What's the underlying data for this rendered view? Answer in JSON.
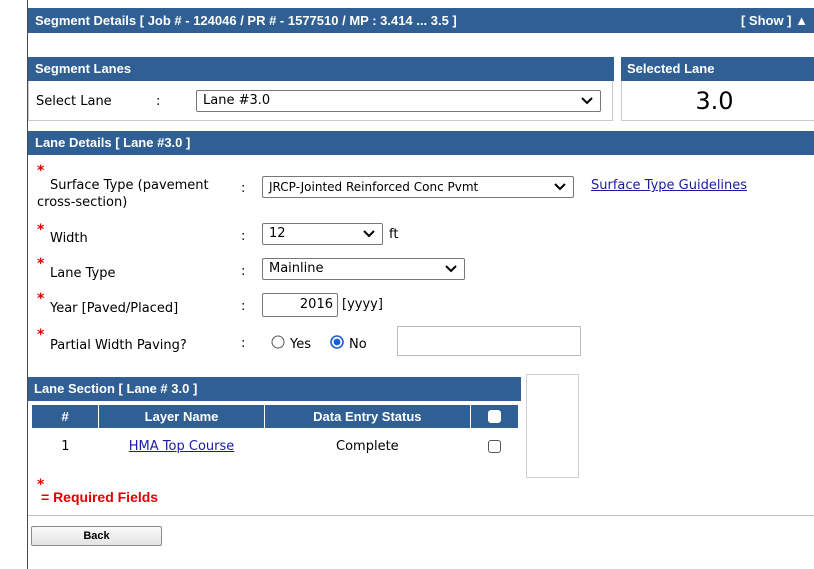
{
  "segment_header": {
    "title": "Segment Details [ Job # - 124046 / PR # - 1577510 / MP : 3.414 ... 3.5 ]",
    "toggle_label": "[ Show ] ▲"
  },
  "segment_lanes": {
    "title": "Segment Lanes",
    "select_label": "Select Lane",
    "colon": ":",
    "selected_value": "Lane #3.0"
  },
  "selected_lane": {
    "title": "Selected Lane",
    "value": "3.0"
  },
  "lane_details": {
    "title": "Lane Details [ Lane #3.0 ]",
    "required_mark": "*",
    "colon": ":",
    "surface_type": {
      "label_line1": "Surface Type (pavement",
      "label_line2": "cross-section)",
      "value": "JRCP-Jointed Reinforced Conc Pvmt",
      "guidelines_link": "Surface Type Guidelines"
    },
    "width": {
      "label": "Width",
      "value": "12",
      "unit": "ft"
    },
    "lane_type": {
      "label": "Lane Type",
      "value": "Mainline"
    },
    "year": {
      "label": "Year [Paved/Placed]",
      "value": "2016",
      "hint": "[yyyy]"
    },
    "partial_width": {
      "label": "Partial Width Paving?",
      "yes_label": "Yes",
      "no_label": "No",
      "selected": "No"
    }
  },
  "lane_section": {
    "title": "Lane Section [ Lane # 3.0 ]",
    "columns": [
      "#",
      "Layer Name",
      "Data Entry Status"
    ],
    "rows": [
      {
        "num": "1",
        "layer_name": "HMA Top Course",
        "status": "Complete"
      }
    ]
  },
  "footer": {
    "required_mark": "*",
    "required_text": "= Required Fields",
    "back_label": "Back"
  },
  "colors": {
    "header_blue": "#2f5f93",
    "required_red": "#e00000",
    "link_blue": "#1a1aa6"
  }
}
